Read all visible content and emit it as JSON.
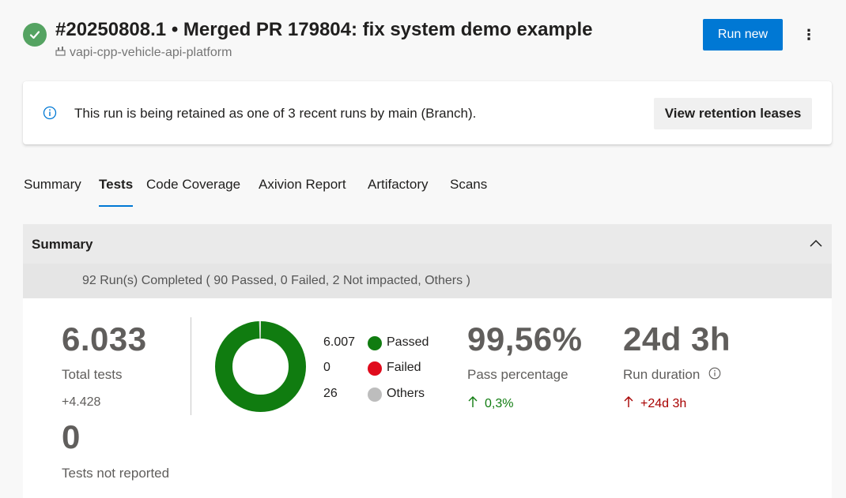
{
  "header": {
    "title": "#20250808.1 • Merged PR 179804: fix system demo example",
    "repo": "vapi-cpp-vehicle-api-platform",
    "run_new_label": "Run new",
    "more_label": "⋮",
    "status_color": "#55a362"
  },
  "banner": {
    "text": "This run is being retained as one of 3 recent runs by main (Branch).",
    "button_label": "View retention leases"
  },
  "tabs": [
    {
      "label": "Summary",
      "active": false
    },
    {
      "label": "Tests",
      "active": true
    },
    {
      "label": "Code Coverage",
      "active": false
    },
    {
      "label": "Axivion Report",
      "active": false
    },
    {
      "label": "Artifactory",
      "active": false
    },
    {
      "label": "Scans",
      "active": false
    }
  ],
  "summary": {
    "title": "Summary",
    "runs_completed": "92 Run(s) Completed ( 90 Passed, 0 Failed, 2 Not impacted, Others )",
    "total_tests": {
      "value": "6.033",
      "label": "Total tests",
      "delta": "+4.428"
    },
    "not_reported": {
      "value": "0",
      "label": "Tests not reported"
    },
    "breakdown": [
      {
        "count": "6.007",
        "label": "Passed",
        "color": "#107c10",
        "value": 6007
      },
      {
        "count": "0",
        "label": "Failed",
        "color": "#e00b1c",
        "value": 0
      },
      {
        "count": "26",
        "label": "Others",
        "color": "#bdbdbd",
        "value": 26
      }
    ],
    "pass_percentage": {
      "value": "99,56%",
      "label": "Pass percentage",
      "delta": "0,3%"
    },
    "run_duration": {
      "value": "24d 3h",
      "label": "Run duration",
      "delta": "+24d 3h"
    }
  },
  "colors": {
    "accent": "#0078d4",
    "passed": "#107c10",
    "failed": "#e00b1c",
    "others": "#bdbdbd",
    "delta_up_good": "#107c10",
    "delta_up_bad": "#a80000"
  }
}
